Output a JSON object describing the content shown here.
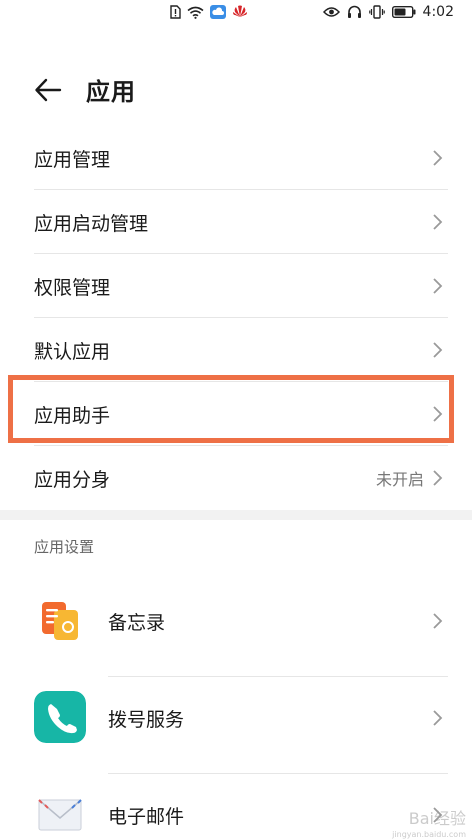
{
  "status_bar": {
    "time": "4:02",
    "icons_center": [
      "sim-alert-icon",
      "wifi-icon",
      "cloud-icon",
      "huawei-logo-icon"
    ],
    "icons_right": [
      "eye-icon",
      "headphones-icon",
      "vibrate-icon",
      "battery-icon"
    ]
  },
  "header": {
    "title": "应用",
    "back_icon": "arrow-left-icon"
  },
  "list": {
    "items": [
      {
        "label": "应用管理",
        "value": ""
      },
      {
        "label": "应用启动管理",
        "value": ""
      },
      {
        "label": "权限管理",
        "value": ""
      },
      {
        "label": "默认应用",
        "value": ""
      },
      {
        "label": "应用助手",
        "value": "",
        "highlighted": true
      },
      {
        "label": "应用分身",
        "value": "未开启"
      }
    ]
  },
  "settings_section": {
    "header": "应用设置",
    "apps": [
      {
        "label": "备忘录",
        "icon": "notes-app-icon"
      },
      {
        "label": "拨号服务",
        "icon": "phone-app-icon"
      },
      {
        "label": "电子邮件",
        "icon": "email-app-icon"
      }
    ]
  },
  "colors": {
    "highlight": "#ee7046",
    "notes_orange": "#f26a2e",
    "notes_yellow": "#f7b733",
    "phone_teal": "#17b6a6"
  },
  "watermark": {
    "text": "Bai经验",
    "sub": "jingyan.baidu.com"
  }
}
